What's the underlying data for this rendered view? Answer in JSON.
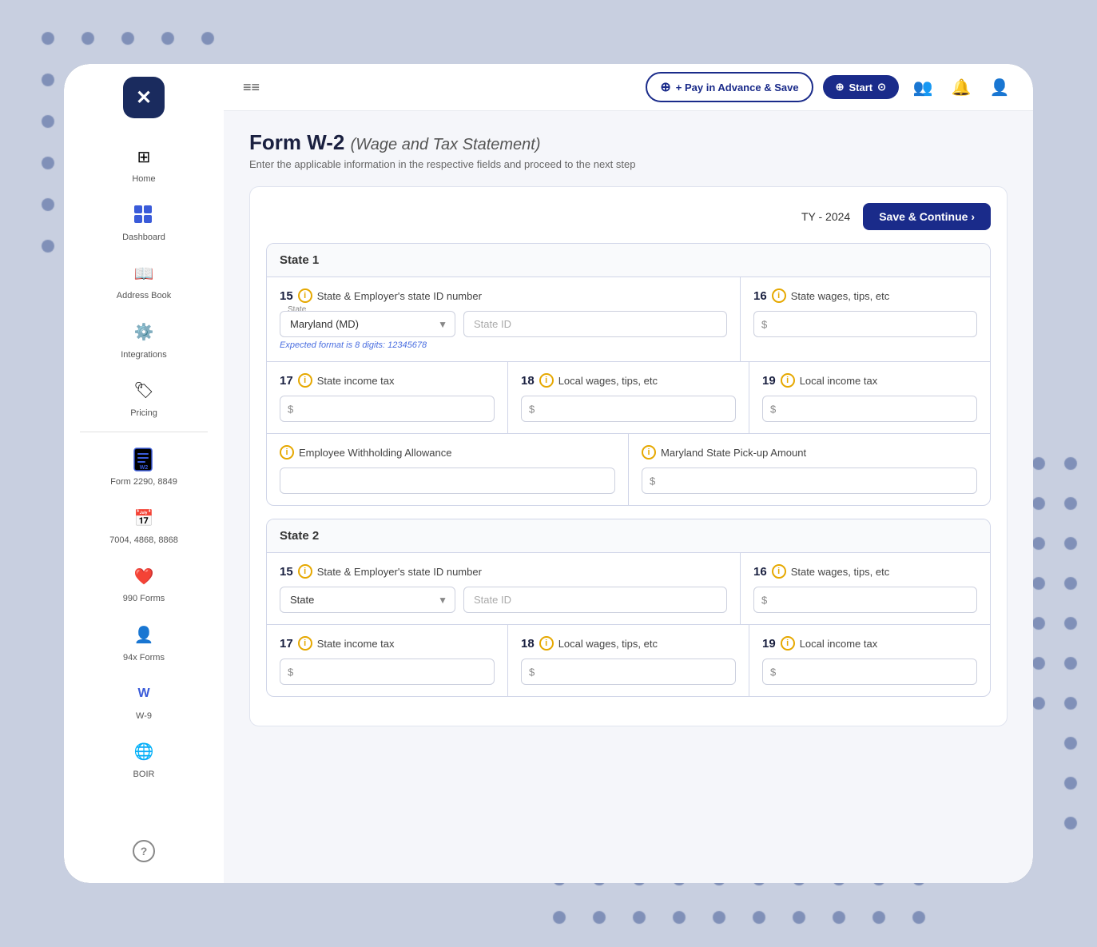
{
  "app": {
    "logo_text": "✕",
    "title": "Form W-2",
    "title_subtitle": "(Wage and Tax Statement)",
    "subtitle": "Enter the applicable information in the respective fields and proceed to the next step"
  },
  "navbar": {
    "hamburger": "≡",
    "pay_advance_label": "+ Pay in Advance & Save",
    "start_label": "+ Start ⊙",
    "tax_year": "TY - 2024",
    "save_continue_label": "Save & Continue ›"
  },
  "sidebar": {
    "items": [
      {
        "label": "Home",
        "icon": "⊞"
      },
      {
        "label": "Dashboard",
        "icon": "📊"
      },
      {
        "label": "Address Book",
        "icon": "📖"
      },
      {
        "label": "Integrations",
        "icon": "🔧"
      },
      {
        "label": "Pricing",
        "icon": "🏷"
      },
      {
        "label": "Form 2290, 8849",
        "icon": "📋"
      },
      {
        "label": "7004, 4868, 8868",
        "icon": "📅"
      },
      {
        "label": "990 Forms",
        "icon": "❤"
      },
      {
        "label": "94x Forms",
        "icon": "👤"
      },
      {
        "label": "W-9",
        "icon": "W"
      },
      {
        "label": "BOIR",
        "icon": "🌐"
      }
    ]
  },
  "form": {
    "state1": {
      "header": "State 1",
      "field15_number": "15",
      "field15_title": "State & Employer's state ID number",
      "state_label": "State",
      "state_value": "Maryland (MD)",
      "state_id_placeholder": "State ID",
      "format_hint": "Expected format is 8 digits: 12345678",
      "field16_number": "16",
      "field16_title": "State wages, tips, etc",
      "field17_number": "17",
      "field17_title": "State income tax",
      "field18_number": "18",
      "field18_title": "Local wages, tips, etc",
      "field19_number": "19",
      "field19_title": "Local income tax",
      "emp_allowance_title": "Employee Withholding Allowance",
      "md_pickup_title": "Maryland State Pick-up Amount"
    },
    "state2": {
      "header": "State 2",
      "field15_number": "15",
      "field15_title": "State & Employer's state ID number",
      "state_placeholder": "State",
      "state_id_placeholder": "State ID",
      "field16_number": "16",
      "field16_title": "State wages, tips, etc",
      "field17_number": "17",
      "field17_title": "State income tax",
      "field18_number": "18",
      "field18_title": "Local wages, tips, etc",
      "field19_number": "19",
      "field19_title": "Local income tax"
    }
  }
}
